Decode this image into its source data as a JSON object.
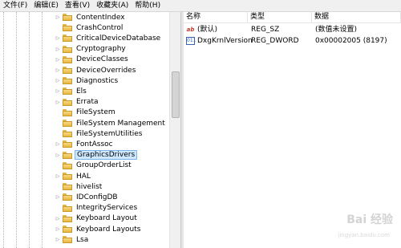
{
  "menu": [
    "文件(F)",
    "编辑(E)",
    "查看(V)",
    "收藏夹(A)",
    "帮助(H)"
  ],
  "tree": {
    "items": [
      {
        "label": "ContentIndex",
        "expander": true
      },
      {
        "label": "CrashControl",
        "expander": false
      },
      {
        "label": "CriticalDeviceDatabase",
        "expander": true
      },
      {
        "label": "Cryptography",
        "expander": true
      },
      {
        "label": "DeviceClasses",
        "expander": true
      },
      {
        "label": "DeviceOverrides",
        "expander": true
      },
      {
        "label": "Diagnostics",
        "expander": true
      },
      {
        "label": "Els",
        "expander": true
      },
      {
        "label": "Errata",
        "expander": true
      },
      {
        "label": "FileSystem",
        "expander": false
      },
      {
        "label": "FileSystem Management",
        "expander": false
      },
      {
        "label": "FileSystemUtilities",
        "expander": false
      },
      {
        "label": "FontAssoc",
        "expander": true
      },
      {
        "label": "GraphicsDrivers",
        "expander": true,
        "selected": true
      },
      {
        "label": "GroupOrderList",
        "expander": false
      },
      {
        "label": "HAL",
        "expander": true
      },
      {
        "label": "hivelist",
        "expander": false
      },
      {
        "label": "IDConfigDB",
        "expander": true
      },
      {
        "label": "IntegrityServices",
        "expander": false
      },
      {
        "label": "Keyboard Layout",
        "expander": true
      },
      {
        "label": "Keyboard Layouts",
        "expander": true
      },
      {
        "label": "Lsa",
        "expander": true
      }
    ]
  },
  "list": {
    "headers": [
      "名称",
      "类型",
      "数据"
    ],
    "rows": [
      {
        "icon": "string-value-icon",
        "name": "(默认)",
        "type": "REG_SZ",
        "data": "(数值未设置)"
      },
      {
        "icon": "dword-value-icon",
        "name": "DxgKrnlVersion",
        "type": "REG_DWORD",
        "data": "0x00002005 (8197)"
      }
    ]
  },
  "icon_glyphs": {
    "sz": "ab",
    "dword": "011"
  },
  "watermark": {
    "main": "Bai 经验",
    "sub": "jingyan.baidu.com"
  },
  "colors": {
    "selection": "#cde8ff",
    "selection_border": "#7eb4ea",
    "folder": "#e8b840"
  }
}
